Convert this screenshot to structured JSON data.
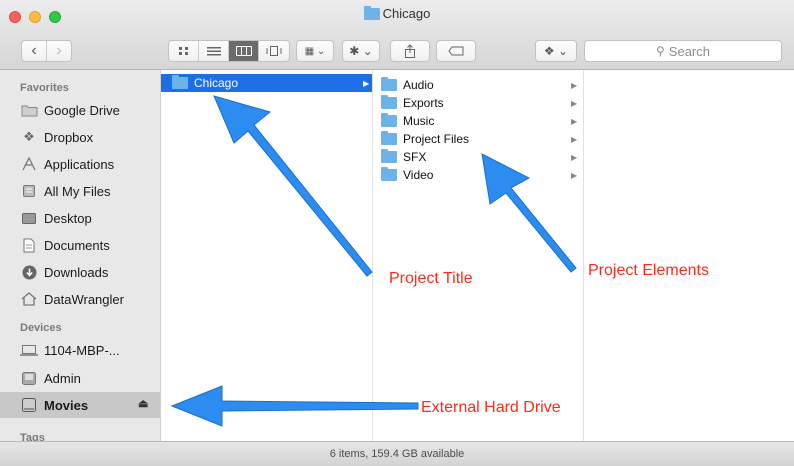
{
  "window": {
    "title": "Chicago"
  },
  "toolbar": {
    "back": "‹",
    "forward": "›",
    "view_icons": [
      "icon-view",
      "list-view",
      "column-view",
      "cover-flow-view"
    ],
    "search_placeholder": "Search"
  },
  "sidebar": {
    "favorites_header": "Favorites",
    "favorites": [
      {
        "label": "Google Drive",
        "icon": "folder-icon"
      },
      {
        "label": "Dropbox",
        "icon": "dropbox-icon"
      },
      {
        "label": "Applications",
        "icon": "applications-icon"
      },
      {
        "label": "All My Files",
        "icon": "all-files-icon"
      },
      {
        "label": "Desktop",
        "icon": "desktop-icon"
      },
      {
        "label": "Documents",
        "icon": "documents-icon"
      },
      {
        "label": "Downloads",
        "icon": "downloads-icon"
      },
      {
        "label": "DataWrangler",
        "icon": "home-icon"
      }
    ],
    "devices_header": "Devices",
    "devices": [
      {
        "label": "1104-MBP-...",
        "icon": "laptop-icon"
      },
      {
        "label": "Admin",
        "icon": "disk-icon"
      },
      {
        "label": "Movies",
        "icon": "external-drive-icon",
        "selected": true
      }
    ],
    "tags_header": "Tags"
  },
  "columns": {
    "col1": [
      {
        "label": "Chicago",
        "selected": true
      }
    ],
    "col2": [
      {
        "label": "Audio"
      },
      {
        "label": "Exports"
      },
      {
        "label": "Music"
      },
      {
        "label": "Project Files"
      },
      {
        "label": "SFX"
      },
      {
        "label": "Video"
      }
    ]
  },
  "status": {
    "text": "6 items, 159.4 GB available"
  },
  "annotations": {
    "project_title": "Project Title",
    "project_elements": "Project Elements",
    "external_drive": "External Hard Drive"
  },
  "colors": {
    "selection": "#1e6ee6",
    "annotation_text": "#ff2a1a",
    "arrow": "#2d8cf0"
  }
}
